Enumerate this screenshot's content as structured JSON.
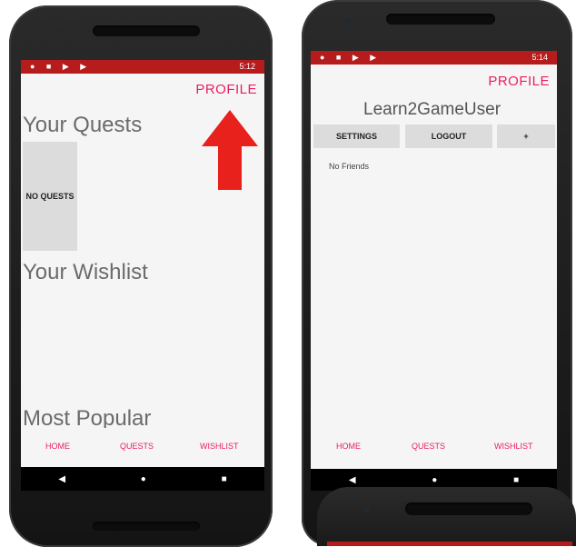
{
  "left_screen": {
    "status": {
      "left_icons": "● ■ ▶ ▶",
      "right": "5:12"
    },
    "profile_label": "PROFILE",
    "quests_title": "Your Quests",
    "no_quests_label": "NO QUESTS",
    "wishlist_title": "Your Wishlist",
    "popular_title": "Most Popular",
    "nav": {
      "home": "HOME",
      "quests": "QUESTS",
      "wishlist": "WISHLIST"
    }
  },
  "right_screen": {
    "status": {
      "left_icons": "● ■ ▶ ▶",
      "right": "5:14"
    },
    "profile_label": "PROFILE",
    "username": "Learn2GameUser",
    "buttons": {
      "settings": "SETTINGS",
      "logout": "LOGOUT",
      "add": "+"
    },
    "friends_status": "No Friends",
    "nav": {
      "home": "HOME",
      "quests": "QUESTS",
      "wishlist": "WISHLIST"
    }
  },
  "android_nav": {
    "back": "◀",
    "home": "●",
    "recents": "■"
  },
  "colors": {
    "status_bar": "#b71c1c",
    "accent": "#e91e63",
    "arrow": "#e8211d"
  },
  "icons": {
    "arrow": "up-arrow-icon"
  }
}
